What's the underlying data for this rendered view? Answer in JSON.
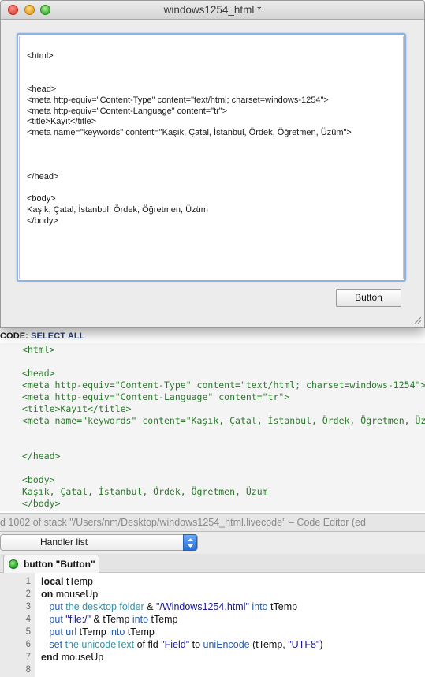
{
  "window": {
    "title": "windows1254_html *",
    "field_lines": [
      "<html>",
      "",
      "",
      "<head>",
      "<meta http-equiv=\"Content-Type\" content=\"text/html; charset=windows-1254\">",
      "<meta http-equiv=\"Content-Language\" content=\"tr\">",
      "<title>Kayıt</title>",
      "<meta name=\"keywords\" content=\"Kaşık, Çatal, İstanbul, Ördek, Öğretmen, Üzüm\">",
      "",
      "",
      "",
      "</head>",
      "",
      "<body>",
      "Kaşık, Çatal, İstanbul, Ördek, Öğretmen, Üzüm",
      "</body>"
    ],
    "button_label": "Button"
  },
  "code_snippet": {
    "header_prefix": "CODE: ",
    "select_all_label": "SELECT ALL",
    "lines": [
      "<html>",
      "",
      "<head>",
      "<meta http-equiv=\"Content-Type\" content=\"text/html; charset=windows-1254\">",
      "<meta http-equiv=\"Content-Language\" content=\"tr\">",
      "<title>Kayıt</title>",
      "<meta name=\"keywords\" content=\"Kaşık, Çatal, İstanbul, Ördek, Öğretmen, Üzüm\">",
      "",
      "",
      "</head>",
      "",
      "<body>",
      "Kaşık, Çatal, İstanbul, Ördek, Öğretmen, Üzüm",
      "</body>"
    ]
  },
  "status_bar": {
    "text": "d 1002 of stack \"/Users/nm/Desktop/windows1254_html.livecode\" – Code Editor (ed"
  },
  "handler_list": {
    "label": "Handler list"
  },
  "tab": {
    "label": "button \"Button\""
  },
  "script": {
    "line_numbers": [
      "1",
      "2",
      "3",
      "4",
      "5",
      "6",
      "7",
      "8"
    ],
    "lines": [
      [
        {
          "t": "local",
          "c": "kw"
        },
        {
          "t": " tTemp",
          "c": "plain"
        }
      ],
      [
        {
          "t": "on",
          "c": "kw"
        },
        {
          "t": " mouseUp",
          "c": "plain"
        }
      ],
      [
        {
          "t": "   put",
          "c": "cmd"
        },
        {
          "t": " the desktop folder",
          "c": "prop"
        },
        {
          "t": " & ",
          "c": "plain"
        },
        {
          "t": "\"/Windows1254.html\"",
          "c": "str"
        },
        {
          "t": " into",
          "c": "cmd"
        },
        {
          "t": " tTemp",
          "c": "plain"
        }
      ],
      [
        {
          "t": "   put",
          "c": "cmd"
        },
        {
          "t": " \"file:/\"",
          "c": "str"
        },
        {
          "t": " & tTemp ",
          "c": "plain"
        },
        {
          "t": "into",
          "c": "cmd"
        },
        {
          "t": " tTemp",
          "c": "plain"
        }
      ],
      [
        {
          "t": "   put url",
          "c": "cmd"
        },
        {
          "t": " tTemp ",
          "c": "plain"
        },
        {
          "t": "into",
          "c": "cmd"
        },
        {
          "t": " tTemp",
          "c": "plain"
        }
      ],
      [
        {
          "t": "   set",
          "c": "cmd"
        },
        {
          "t": " the unicodeText",
          "c": "prop"
        },
        {
          "t": " of fld ",
          "c": "plain"
        },
        {
          "t": "\"Field\"",
          "c": "str"
        },
        {
          "t": " to ",
          "c": "plain"
        },
        {
          "t": "uniEncode",
          "c": "cmd"
        },
        {
          "t": " (tTemp, ",
          "c": "plain"
        },
        {
          "t": "\"UTF8\"",
          "c": "str"
        },
        {
          "t": ")",
          "c": "plain"
        }
      ],
      [
        {
          "t": "end",
          "c": "kw"
        },
        {
          "t": " mouseUp",
          "c": "plain"
        }
      ],
      []
    ]
  },
  "colors": {
    "code_green": "#2a7a2a",
    "field_focus_ring": "#8db2e6",
    "select_all": "#2a3f74"
  }
}
